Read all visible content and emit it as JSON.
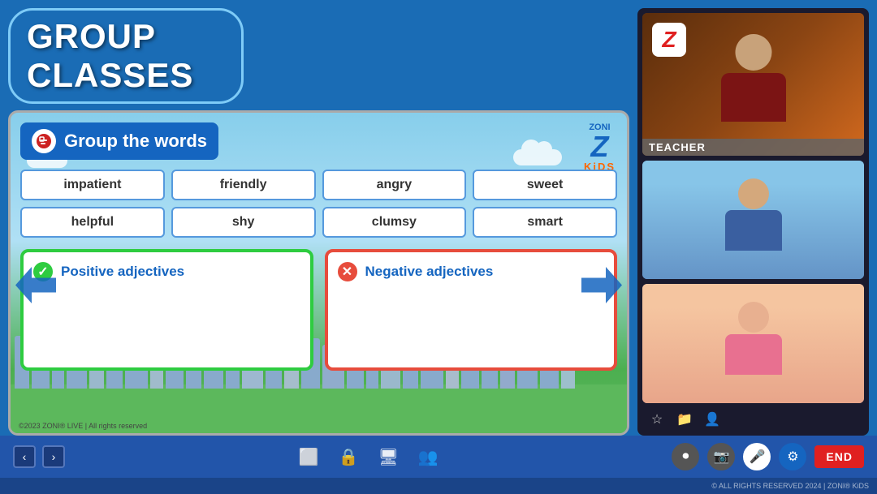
{
  "banner": {
    "title": "GROUP CLASSES"
  },
  "activity": {
    "title": "Group the words",
    "words": [
      {
        "id": "w1",
        "text": "impatient"
      },
      {
        "id": "w2",
        "text": "friendly"
      },
      {
        "id": "w3",
        "text": "angry"
      },
      {
        "id": "w4",
        "text": "sweet"
      },
      {
        "id": "w5",
        "text": "helpful"
      },
      {
        "id": "w6",
        "text": "shy"
      },
      {
        "id": "w7",
        "text": "clumsy"
      },
      {
        "id": "w8",
        "text": "smart"
      }
    ],
    "positive_label": "Positive adjectives",
    "negative_label": "Negative adjectives",
    "copyright": "©2023 ZONI® LIVE | All rights reserved"
  },
  "zoni": {
    "z_letter": "Z",
    "brand_top": "ZONI",
    "brand_bottom": "KiDS"
  },
  "right_panel": {
    "teacher_label": "TEACHER"
  },
  "bottom_bar": {
    "prev_icon": "‹",
    "next_icon": "›",
    "screen_icon": "⬜",
    "lock_icon": "🔒",
    "monitor_icon": "🖥",
    "users_icon": "👥",
    "record_icon": "⏺",
    "camera_icon": "📷",
    "mic_icon": "🎤",
    "settings_icon": "⚙",
    "end_label": "END"
  },
  "watermark": "© ALL RIGHTS RESERVED 2024 | ZONI® KiDS"
}
